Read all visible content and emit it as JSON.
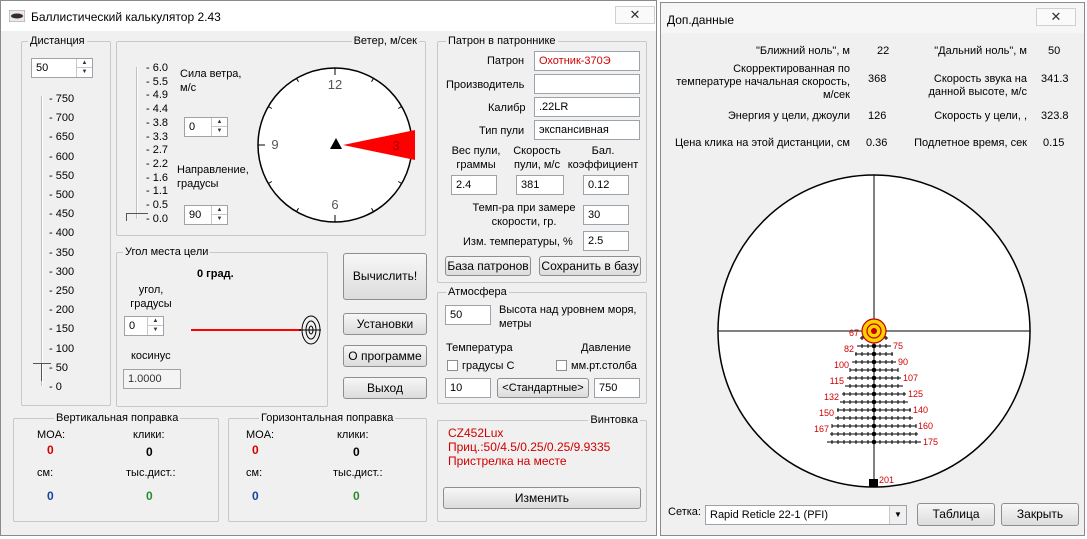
{
  "main_window": {
    "title": "Баллистический калькулятор 2.43",
    "close": "✕",
    "distance": {
      "group_label": "Дистанция",
      "value": "50",
      "ticks": [
        "750",
        "700",
        "650",
        "600",
        "550",
        "500",
        "450",
        "400",
        "350",
        "300",
        "250",
        "200",
        "150",
        "100",
        "50",
        "0"
      ]
    },
    "wind": {
      "group_label": "Ветер, м/сек",
      "speed_ticks": [
        "6.0",
        "5.5",
        "4.9",
        "4.4",
        "3.8",
        "3.3",
        "2.7",
        "2.2",
        "1.6",
        "1.1",
        "0.5",
        "0.0"
      ],
      "speed_label": "Сила ветра, м/с",
      "speed_value": "0",
      "direction_label": "Направление, градусы",
      "direction_value": "90",
      "clock": [
        "12",
        "3",
        "6",
        "9"
      ]
    },
    "angle": {
      "group_label": "Угол места цели",
      "degrees_display": "0 град.",
      "angle_label": "угол, градусы",
      "angle_value": "0",
      "cosine_label": "косинус",
      "cosine_value": "1.0000"
    },
    "buttons": {
      "calculate": "Вычислить!",
      "settings": "Установки",
      "about": "О программе",
      "exit": "Выход"
    },
    "cartridge": {
      "group_label": "Патрон в патроннике",
      "cartridge_label": "Патрон",
      "cartridge_value": "Охотник-370Э",
      "maker_label": "Производитель",
      "maker_value": "",
      "caliber_label": "Калибр",
      "caliber_value": ".22LR",
      "bullet_type_label": "Тип пули",
      "bullet_type_value": "экспансивная",
      "weight_label": "Вес пули, граммы",
      "weight_value": "2.4",
      "velocity_label": "Скорость пули, м/с",
      "velocity_value": "381",
      "bc_label": "Бал. коэффициент",
      "bc_value": "0.12",
      "temp_label": "Темп-ра при замере скорости, гр.",
      "temp_value": "30",
      "temp_change_label": "Изм. температуры, %",
      "temp_change_value": "2.5",
      "db_button": "База патронов",
      "save_button": "Сохранить в базу"
    },
    "atmosphere": {
      "group_label": "Атмосфера",
      "altitude_value": "50",
      "altitude_label": "Высота над уровнем моря, метры",
      "temperature_label": "Температура",
      "celsius_label": "градусы С",
      "pressure_label": "Давление",
      "mmhg_label": "мм.рт.столба",
      "temperature_value": "10",
      "standard_button": "<Стандартные>",
      "pressure_value": "750"
    },
    "vertical": {
      "group_label": "Вертикальная поправка",
      "moa_label": "MOA:",
      "moa_value": "0",
      "clicks_label": "клики:",
      "clicks_value": "0",
      "cm_label": "см:",
      "cm_value": "0",
      "mil_label": "тыс.дист.:",
      "mil_value": "0"
    },
    "horizontal": {
      "group_label": "Горизонтальная поправка",
      "moa_label": "MOA:",
      "moa_value": "0",
      "clicks_label": "клики:",
      "clicks_value": "0",
      "cm_label": "см:",
      "cm_value": "0",
      "mil_label": "тыс.дист.:",
      "mil_value": "0"
    },
    "rifle": {
      "group_label": "Винтовка",
      "name": "CZ452Lux",
      "scope": "Приц.:50/4.5/0.25/0.25/9.9335",
      "zeroing": "Пристрелка на месте",
      "change_button": "Изменить"
    }
  },
  "extra_window": {
    "title": "Доп.данные",
    "close": "✕",
    "near_zero_label": "\"Ближний ноль\", м",
    "near_zero_value": "22",
    "far_zero_label": "\"Дальний ноль\", м",
    "far_zero_value": "50",
    "corrected_velocity_label": "Скорректированная по температуре начальная скорость, м/сек",
    "corrected_velocity_value": "368",
    "sound_speed_label": "Скорость звука на данной высоте, м/с",
    "sound_speed_value": "341.3",
    "energy_label": "Энергия у цели, джоули",
    "energy_value": "126",
    "target_velocity_label": "Скорость у цели, ,",
    "target_velocity_value": "323.8",
    "click_price_label": "Цена клика на этой дистанции, см",
    "click_price_value": "0.36",
    "flight_time_label": "Подлетное время, сек",
    "flight_time_value": "0.15",
    "reticle_label": "Сетка:",
    "reticle_value": "Rapid Reticle 22-1 (PFI)",
    "table_button": "Таблица",
    "close_button": "Закрыть",
    "reticle_marks_left": [
      "67",
      "82",
      "100",
      "115",
      "132",
      "150",
      "167"
    ],
    "reticle_marks_right": [
      "75",
      "90",
      "107",
      "125",
      "140",
      "160",
      "175"
    ],
    "reticle_bottom_mark": "201"
  },
  "colors": {
    "accent_red": "#d00000",
    "marker_red": "#ff0000",
    "value_blue": "#1a3f9e",
    "value_green": "#2a8a2a",
    "bullseye_yellow": "#ffd000"
  }
}
